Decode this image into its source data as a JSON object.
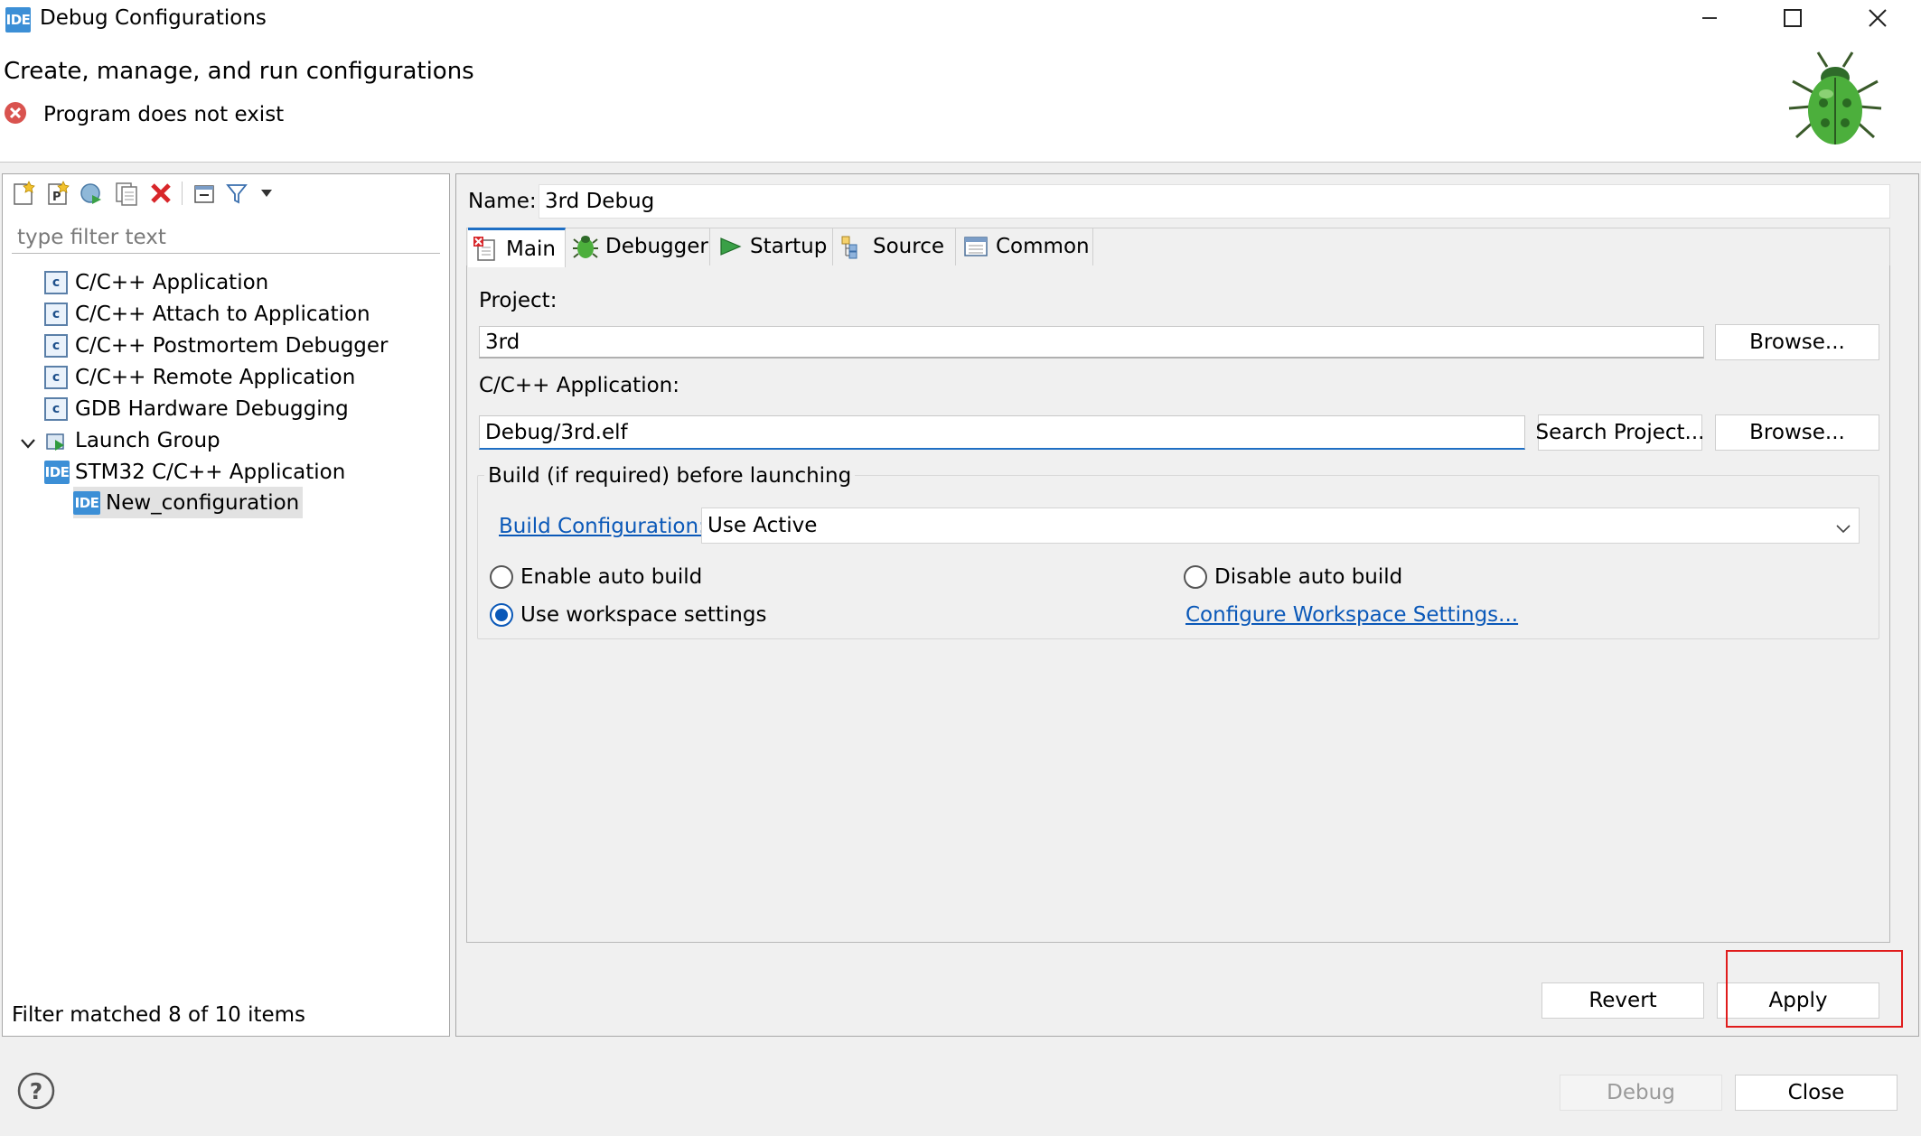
{
  "window": {
    "app_badge": "IDE",
    "title": "Debug Configurations",
    "minimize_icon": "minimize-icon",
    "maximize_icon": "maximize-icon",
    "close_icon": "close-icon"
  },
  "header": {
    "title": "Create, manage, and run configurations",
    "error_message": "Program does not exist",
    "error_icon": "error-icon",
    "banner_icon": "bug-icon"
  },
  "left": {
    "toolbar_icons": [
      "new-configuration-icon",
      "new-prototype-icon",
      "export-icon",
      "duplicate-icon",
      "delete-icon",
      "collapse-all-icon",
      "filter-icon",
      "view-menu-icon"
    ],
    "filter_placeholder": "type filter text",
    "tree": [
      {
        "label": "C/C++ Application",
        "icon": "c-app-icon"
      },
      {
        "label": "C/C++ Attach to Application",
        "icon": "c-app-icon"
      },
      {
        "label": "C/C++ Postmortem Debugger",
        "icon": "c-app-icon"
      },
      {
        "label": "C/C++ Remote Application",
        "icon": "c-app-icon"
      },
      {
        "label": "GDB Hardware Debugging",
        "icon": "c-app-icon"
      },
      {
        "label": "Launch Group",
        "icon": "launch-group-icon"
      },
      {
        "label": "STM32 C/C++ Application",
        "icon": "ide-icon",
        "expanded": true
      },
      {
        "label": "New_configuration",
        "icon": "ide-icon",
        "selected": true
      }
    ],
    "ide_badge": "IDE",
    "c_badge": "c",
    "status": "Filter matched 8 of 10 items"
  },
  "right": {
    "name_label": "Name:",
    "name_value": "3rd Debug",
    "tabs": [
      {
        "label": "Main",
        "icon": "main-tab-icon",
        "active": true
      },
      {
        "label": "Debugger",
        "icon": "debugger-tab-icon"
      },
      {
        "label": "Startup",
        "icon": "startup-tab-icon"
      },
      {
        "label": "Source",
        "icon": "source-tab-icon"
      },
      {
        "label": "Common",
        "icon": "common-tab-icon"
      }
    ],
    "project_label": "Project:",
    "project_value": "3rd",
    "browse_label": "Browse...",
    "app_label": "C/C++ Application:",
    "app_value": "Debug/3rd.elf",
    "search_project_label": "Search Project...",
    "build_group_label": "Build (if required) before launching",
    "build_config_link": "Build Configuration:",
    "build_config_value": "Use Active",
    "radio_enable": "Enable auto build",
    "radio_disable": "Disable auto build",
    "radio_workspace": "Use workspace settings",
    "radio_selected": "Use workspace settings",
    "configure_link": "Configure Workspace Settings...",
    "revert_label": "Revert",
    "apply_label": "Apply",
    "highlight_color": "#e01c1c"
  },
  "footer": {
    "help_icon": "help-icon",
    "debug_label": "Debug",
    "close_label": "Close"
  }
}
